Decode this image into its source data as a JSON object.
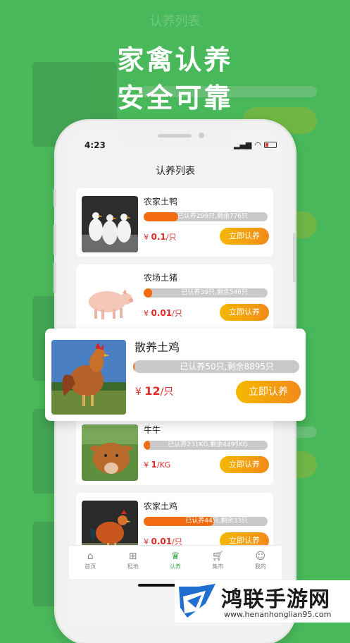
{
  "ghost": {
    "title": "认养列表"
  },
  "headline": {
    "line1": "家禽认养",
    "line2": "安全可靠"
  },
  "status": {
    "time": "4:23"
  },
  "nav": {
    "title": "认养列表"
  },
  "items": [
    {
      "name": "农家土鸭",
      "progress_text": "已认养299只,剩余776只",
      "progress": 0.28,
      "currency": "¥",
      "price": "0.1",
      "unit": "/只",
      "button": "立即认养"
    },
    {
      "name": "农场土猪",
      "progress_text": "已认养39只,剩余546只",
      "progress": 0.07,
      "currency": "¥",
      "price": "0.01",
      "unit": "/只",
      "button": "立即认养"
    },
    {
      "name": "牛牛",
      "progress_text": "已认养231KG,剩余4495KG",
      "progress": 0.05,
      "currency": "¥",
      "price": "1",
      "unit": "/KG",
      "button": "立即认养"
    },
    {
      "name": "农家土鸡",
      "progress_text": "已认养44只,剩余33只",
      "progress": 0.57,
      "currency": "¥",
      "price": "0.01",
      "unit": "/只",
      "button": "立即认养"
    }
  ],
  "featured": {
    "name": "散养土鸡",
    "progress_text": "已认养50只,剩余8895只",
    "progress": 0.006,
    "currency": "¥",
    "price": "12",
    "unit": "/只",
    "button": "立即认养"
  },
  "tabs": [
    {
      "label": "首页",
      "icon": "home-icon"
    },
    {
      "label": "租地",
      "icon": "grid-icon"
    },
    {
      "label": "认养",
      "icon": "crown-icon"
    },
    {
      "label": "集市",
      "icon": "cart-icon"
    },
    {
      "label": "我的",
      "icon": "user-icon"
    }
  ],
  "watermark": {
    "brand": "鸿联手游网",
    "url": "www.henanhonglian95.com"
  },
  "colors": {
    "brand_green": "#49b85a",
    "accent_orange": "#f26b10",
    "price_red": "#e02a2a",
    "button_yellow": "#f5b800"
  }
}
